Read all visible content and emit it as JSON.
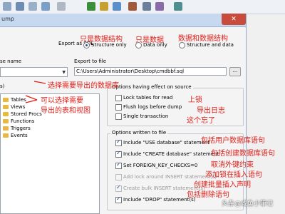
{
  "dialog": {
    "title": "ump",
    "close_label": "✕",
    "export_as_sql_label": "Export as SQL",
    "radios": [
      {
        "label": "Structure only",
        "checked": true
      },
      {
        "label": "Data only",
        "checked": false
      },
      {
        "label": "Structure and data",
        "checked": false
      }
    ],
    "database_name_label": "se name",
    "objects_label": "s)",
    "export_to_file_label": "Export to file",
    "export_path": "C:\\Users\\Administrator\\Desktop\\cmdbbf.sql",
    "browse_label": "...",
    "tree": [
      "Tables",
      "Views",
      "Stored Procs",
      "Functions",
      "Triggers",
      "Events"
    ],
    "options_effect_title": "Options having effect on source",
    "effect_options": [
      {
        "label": "Lock tables for read",
        "checked": false
      },
      {
        "label": "Flush logs before dump",
        "checked": false
      },
      {
        "label": "Single transaction",
        "checked": false
      }
    ],
    "options_written_title": "Options written to file",
    "written_options": [
      {
        "label": "Include \"USE database\" statement",
        "checked": true,
        "disabled": false
      },
      {
        "label": "Include \"CREATE database\" statement",
        "checked": true,
        "disabled": false
      },
      {
        "label": "Set FOREIGN_KEY_CHECKS=0",
        "checked": true,
        "disabled": false
      },
      {
        "label": "Add lock around INSERT statement(s)",
        "checked": false,
        "disabled": true
      },
      {
        "label": "Create bulk INSERT statement(s)",
        "checked": true,
        "disabled": true
      },
      {
        "label": "Include \"DROP\" statement(s)",
        "checked": true,
        "disabled": false
      }
    ]
  },
  "annotations": {
    "structure_only": "只是数据结构",
    "data_only": "只是数据",
    "structure_and_data": "数据和数据结构",
    "select_database": "选择需要导出的数据库",
    "select_tables_1": "可以选择需要",
    "select_tables_2": "导出的表和视图",
    "lock": "上锁",
    "flush_logs": "导出日志",
    "forgot": "这个忘了",
    "use_db": "包括用户数据库语句",
    "create_db": "包括创建数据库语句",
    "fk_checks": "取消外键约束",
    "add_lock": "添加锁在插入语句",
    "bulk_insert": "创建批量插入声明",
    "drop": "包括删除语句"
  },
  "watermark": "头条@咸鱼小筆记",
  "colors": {
    "annotation": "#e0201a",
    "titlebar": "#c7d9ef",
    "close": "#c94b3c"
  }
}
